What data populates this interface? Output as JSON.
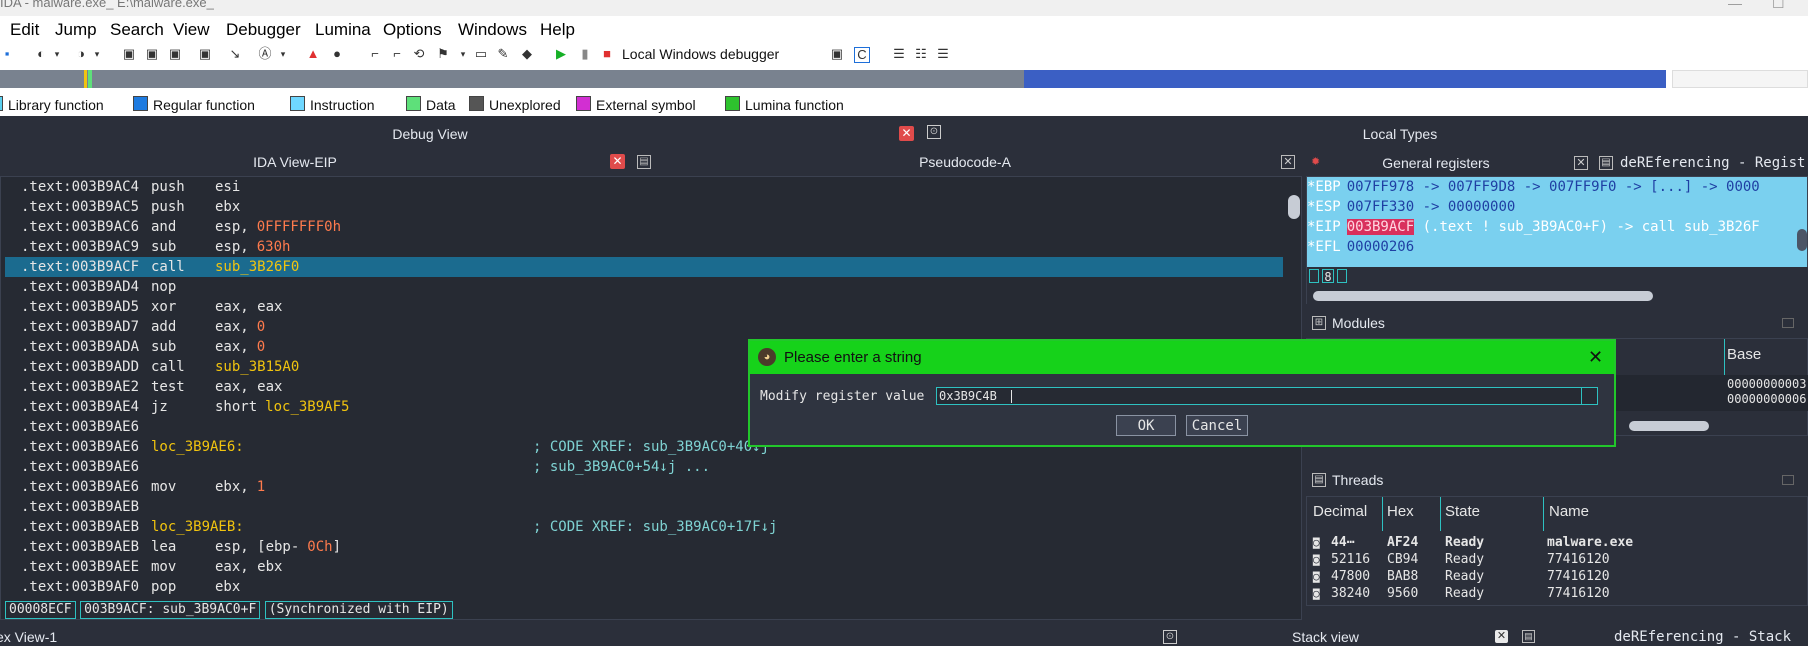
{
  "window": {
    "title": "IDA - malware.exe_ E:\\malware.exe_",
    "min": "—",
    "max": "☐"
  },
  "menu": [
    "Edit",
    "Jump",
    "Search",
    "View",
    "Debugger",
    "Lumina",
    "Options",
    "Windows",
    "Help"
  ],
  "toolbar": {
    "debugger_label": "Local Windows debugger"
  },
  "legend": [
    {
      "label": "Library function",
      "color": "#5ad0f0"
    },
    {
      "label": "Regular function",
      "color": "#1e7be0"
    },
    {
      "label": "Instruction",
      "color": "#6fd7ff"
    },
    {
      "label": "Data",
      "color": "#5ee07a"
    },
    {
      "label": "Unexplored",
      "color": "#555555"
    },
    {
      "label": "External symbol",
      "color": "#d22fd2"
    },
    {
      "label": "Lumina function",
      "color": "#2ec32e"
    }
  ],
  "panels": {
    "debug_view": "Debug View",
    "ida_view": "IDA View-EIP",
    "pseudocode": "Pseudocode-A",
    "local_types": "Local Types",
    "general_registers": "General registers",
    "dereferencing": "deREferencing - Regist",
    "modules": "Modules",
    "threads": "Threads",
    "hex_view": "ex View-1",
    "stack_view": "Stack view",
    "dereferencing_stack": "deREferencing - Stack"
  },
  "code": [
    {
      "addr": ".text:003B9AC4",
      "mn": "push",
      "op": "esi"
    },
    {
      "addr": ".text:003B9AC5",
      "mn": "push",
      "op": "ebx"
    },
    {
      "addr": ".text:003B9AC6",
      "mn": "and",
      "op": "esp,",
      "num": "0FFFFFFF0h"
    },
    {
      "addr": ".text:003B9AC9",
      "mn": "sub",
      "op": "esp,",
      "num": "630h"
    },
    {
      "addr": ".text:003B9ACF",
      "mn": "call",
      "fn": "sub_3B26F0",
      "hl": true
    },
    {
      "addr": ".text:003B9AD4",
      "mn": "nop"
    },
    {
      "addr": ".text:003B9AD5",
      "mn": "xor",
      "op": "eax, eax"
    },
    {
      "addr": ".text:003B9AD7",
      "mn": "add",
      "op": "eax,",
      "num": "0"
    },
    {
      "addr": ".text:003B9ADA",
      "mn": "sub",
      "op": "eax,",
      "num": "0"
    },
    {
      "addr": ".text:003B9ADD",
      "mn": "call",
      "fn": "sub_3B15A0"
    },
    {
      "addr": ".text:003B9AE2",
      "mn": "test",
      "op": "eax, eax"
    },
    {
      "addr": ".text:003B9AE4",
      "mn": "jz",
      "op": "short",
      "fn": "loc_3B9AF5"
    },
    {
      "addr": ".text:003B9AE6"
    },
    {
      "addr": ".text:003B9AE6",
      "lbl": "loc_3B9AE6:",
      "cm": "; CODE XREF: sub_3B9AC0+40↓j"
    },
    {
      "addr": ".text:003B9AE6",
      "cm": "; sub_3B9AC0+54↓j ..."
    },
    {
      "addr": ".text:003B9AE6",
      "mn": "mov",
      "op": "ebx,",
      "num": "1"
    },
    {
      "addr": ".text:003B9AEB"
    },
    {
      "addr": ".text:003B9AEB",
      "lbl": "loc_3B9AEB:",
      "cm": "; CODE XREF: sub_3B9AC0+17F↓j"
    },
    {
      "addr": ".text:003B9AEB",
      "mn": "lea",
      "op": "esp, [ebp-",
      "num": "0Ch",
      "op2": "]"
    },
    {
      "addr": ".text:003B9AEE",
      "mn": "mov",
      "op": "eax, ebx"
    },
    {
      "addr": ".text:003B9AF0",
      "mn": "pop",
      "op": "ebx"
    }
  ],
  "status": {
    "offset": "00008ECF",
    "location": "003B9ACF: sub_3B9AC0+F",
    "sync": "(Synchronized with EIP)"
  },
  "registers": [
    {
      "name": "*EBP",
      "val": "007FF978",
      "rest": " -> 007FF9D8 -> 007FF9F0 -> [...] -> 0000"
    },
    {
      "name": "*ESP",
      "val": "007FF330",
      "rest": " -> 00000000"
    },
    {
      "name": "*EIP",
      "val": "003B9ACF",
      "rest": " (.text ! sub_3B9AC0+F) -> call sub_3B26F",
      "eip": true
    },
    {
      "name": "*EFL",
      "val": "00000206",
      "rest": ""
    }
  ],
  "reg_indicator": "8",
  "modules": {
    "col_base": "Base",
    "base_values": [
      "00000000003",
      "00000000006"
    ]
  },
  "threads": {
    "columns": [
      "Decimal",
      "Hex",
      "State",
      "Name"
    ],
    "rows": [
      {
        "dec": "44⋯",
        "hex": "AF24",
        "state": "Ready",
        "name": "malware.exe"
      },
      {
        "dec": "52116",
        "hex": "CB94",
        "state": "Ready",
        "name": "77416120"
      },
      {
        "dec": "47800",
        "hex": "BAB8",
        "state": "Ready",
        "name": "77416120"
      },
      {
        "dec": "38240",
        "hex": "9560",
        "state": "Ready",
        "name": "77416120"
      }
    ]
  },
  "dialog": {
    "title": "Please enter a string",
    "label": "Modify register value",
    "value": "0x3B9C4B",
    "ok": "OK",
    "cancel": "Cancel"
  }
}
